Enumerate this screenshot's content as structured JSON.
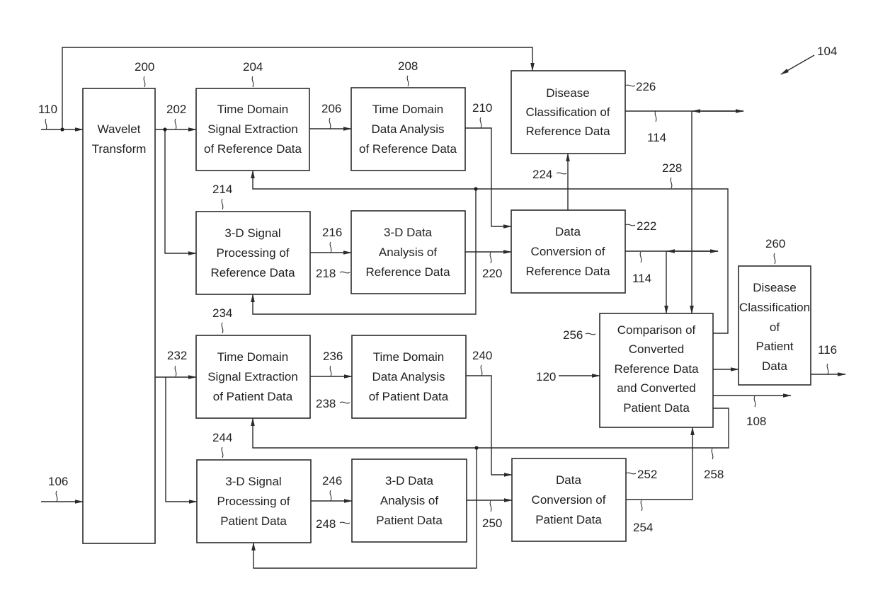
{
  "figure": {
    "ref": "104",
    "colors": {
      "ink": "#2b2b2b",
      "background": "#ffffff"
    }
  },
  "blocks": [
    {
      "id": "wavelet",
      "ref": "200",
      "lines": [
        "Wavelet",
        "Transform"
      ]
    },
    {
      "id": "td-sig-ref",
      "ref": "204",
      "lines": [
        "Time Domain",
        "Signal Extraction",
        "of Reference Data"
      ]
    },
    {
      "id": "td-ana-ref",
      "ref": "208",
      "lines": [
        "Time Domain",
        "Data Analysis",
        "of Reference Data"
      ]
    },
    {
      "id": "dis-cls-ref",
      "ref": "226",
      "lines": [
        "Disease",
        "Classification of",
        "Reference Data"
      ]
    },
    {
      "id": "3d-sig-ref",
      "ref": "214",
      "lines": [
        "3-D Signal",
        "Processing of",
        "Reference Data"
      ]
    },
    {
      "id": "3d-ana-ref",
      "ref": "218",
      "lines": [
        "3-D Data",
        "Analysis of",
        "Reference Data"
      ]
    },
    {
      "id": "conv-ref",
      "ref": "222",
      "lines": [
        "Data",
        "Conversion of",
        "Reference Data"
      ]
    },
    {
      "id": "td-sig-pat",
      "ref": "234",
      "lines": [
        "Time Domain",
        "Signal Extraction",
        "of Patient Data"
      ]
    },
    {
      "id": "td-ana-pat",
      "ref": "238",
      "lines": [
        "Time Domain",
        "Data Analysis",
        "of Patient Data"
      ]
    },
    {
      "id": "compare",
      "ref": "256",
      "lines": [
        "Comparison of",
        "Converted",
        "Reference Data",
        "and Converted",
        "Patient Data"
      ]
    },
    {
      "id": "dis-cls-pat",
      "ref": "260",
      "lines": [
        "Disease",
        "Classification",
        "of",
        "Patient",
        "Data"
      ]
    },
    {
      "id": "3d-sig-pat",
      "ref": "244",
      "lines": [
        "3-D Signal",
        "Processing of",
        "Patient Data"
      ]
    },
    {
      "id": "3d-ana-pat",
      "ref": "248",
      "lines": [
        "3-D Data",
        "Analysis of",
        "Patient Data"
      ]
    },
    {
      "id": "conv-pat",
      "ref": "252",
      "lines": [
        "Data",
        "Conversion of",
        "Patient Data"
      ]
    }
  ],
  "signals": {
    "in_ref": "110",
    "in_pat": "106",
    "wavelet_ref_out": "202",
    "wavelet_pat_out": "232",
    "td_ref_link": "206",
    "td_ref_out": "210",
    "d3_ref_link": "216",
    "d3_ref_out": "220",
    "cls_ref_in": "224",
    "feedback_ref": "228",
    "ref_output_top": "114",
    "ref_output_mid": "114",
    "td_pat_link": "236",
    "td_pat_out": "240",
    "d3_pat_link": "246",
    "d3_pat_out": "250",
    "conv_pat_out": "254",
    "feedback_pat": "258",
    "compare_in": "120",
    "compare_out": "108",
    "cls_pat_out": "116"
  }
}
